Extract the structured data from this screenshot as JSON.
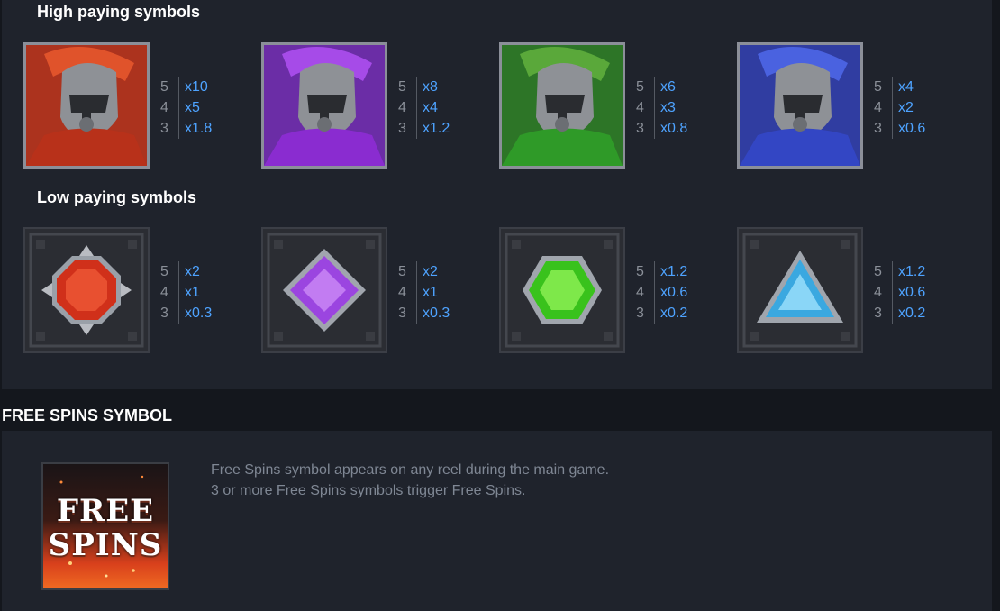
{
  "high": {
    "title": "High paying symbols",
    "symbols": [
      {
        "icon": "red-spartan-warrior-icon",
        "accent": "#c23a22",
        "pays": [
          {
            "count": "5",
            "mult": "x10"
          },
          {
            "count": "4",
            "mult": "x5"
          },
          {
            "count": "3",
            "mult": "x1.8"
          }
        ]
      },
      {
        "icon": "purple-spartan-warrior-icon",
        "accent": "#8b2fd1",
        "pays": [
          {
            "count": "5",
            "mult": "x8"
          },
          {
            "count": "4",
            "mult": "x4"
          },
          {
            "count": "3",
            "mult": "x1.2"
          }
        ]
      },
      {
        "icon": "green-spartan-warrior-icon",
        "accent": "#2f8f2a",
        "pays": [
          {
            "count": "5",
            "mult": "x6"
          },
          {
            "count": "4",
            "mult": "x3"
          },
          {
            "count": "3",
            "mult": "x0.8"
          }
        ]
      },
      {
        "icon": "blue-spartan-warrior-icon",
        "accent": "#3445c2",
        "pays": [
          {
            "count": "5",
            "mult": "x4"
          },
          {
            "count": "4",
            "mult": "x2"
          },
          {
            "count": "3",
            "mult": "x0.6"
          }
        ]
      }
    ]
  },
  "low": {
    "title": "Low paying symbols",
    "symbols": [
      {
        "icon": "red-octagon-gem-icon",
        "accent": "#d0301a",
        "pays": [
          {
            "count": "5",
            "mult": "x2"
          },
          {
            "count": "4",
            "mult": "x1"
          },
          {
            "count": "3",
            "mult": "x0.3"
          }
        ]
      },
      {
        "icon": "purple-diamond-gem-icon",
        "accent": "#9b45e0",
        "pays": [
          {
            "count": "5",
            "mult": "x2"
          },
          {
            "count": "4",
            "mult": "x1"
          },
          {
            "count": "3",
            "mult": "x0.3"
          }
        ]
      },
      {
        "icon": "green-hexagon-gem-icon",
        "accent": "#39c21c",
        "pays": [
          {
            "count": "5",
            "mult": "x1.2"
          },
          {
            "count": "4",
            "mult": "x0.6"
          },
          {
            "count": "3",
            "mult": "x0.2"
          }
        ]
      },
      {
        "icon": "blue-triangle-gem-icon",
        "accent": "#3aa8e0",
        "pays": [
          {
            "count": "5",
            "mult": "x1.2"
          },
          {
            "count": "4",
            "mult": "x0.6"
          },
          {
            "count": "3",
            "mult": "x0.2"
          }
        ]
      }
    ]
  },
  "free_spins": {
    "header": "FREE SPINS SYMBOL",
    "symbol_icon": "free-spins-symbol-icon",
    "symbol_line1": "FREE",
    "symbol_line2": "SPINS",
    "description_line1": "Free Spins symbol appears on any reel during the main game.",
    "description_line2": "3 or more Free Spins symbols trigger Free Spins."
  },
  "colors": {
    "multiplier": "#4ea3ff",
    "count": "#8a8f98",
    "panel": "#1f232c",
    "background": "#14171d"
  }
}
